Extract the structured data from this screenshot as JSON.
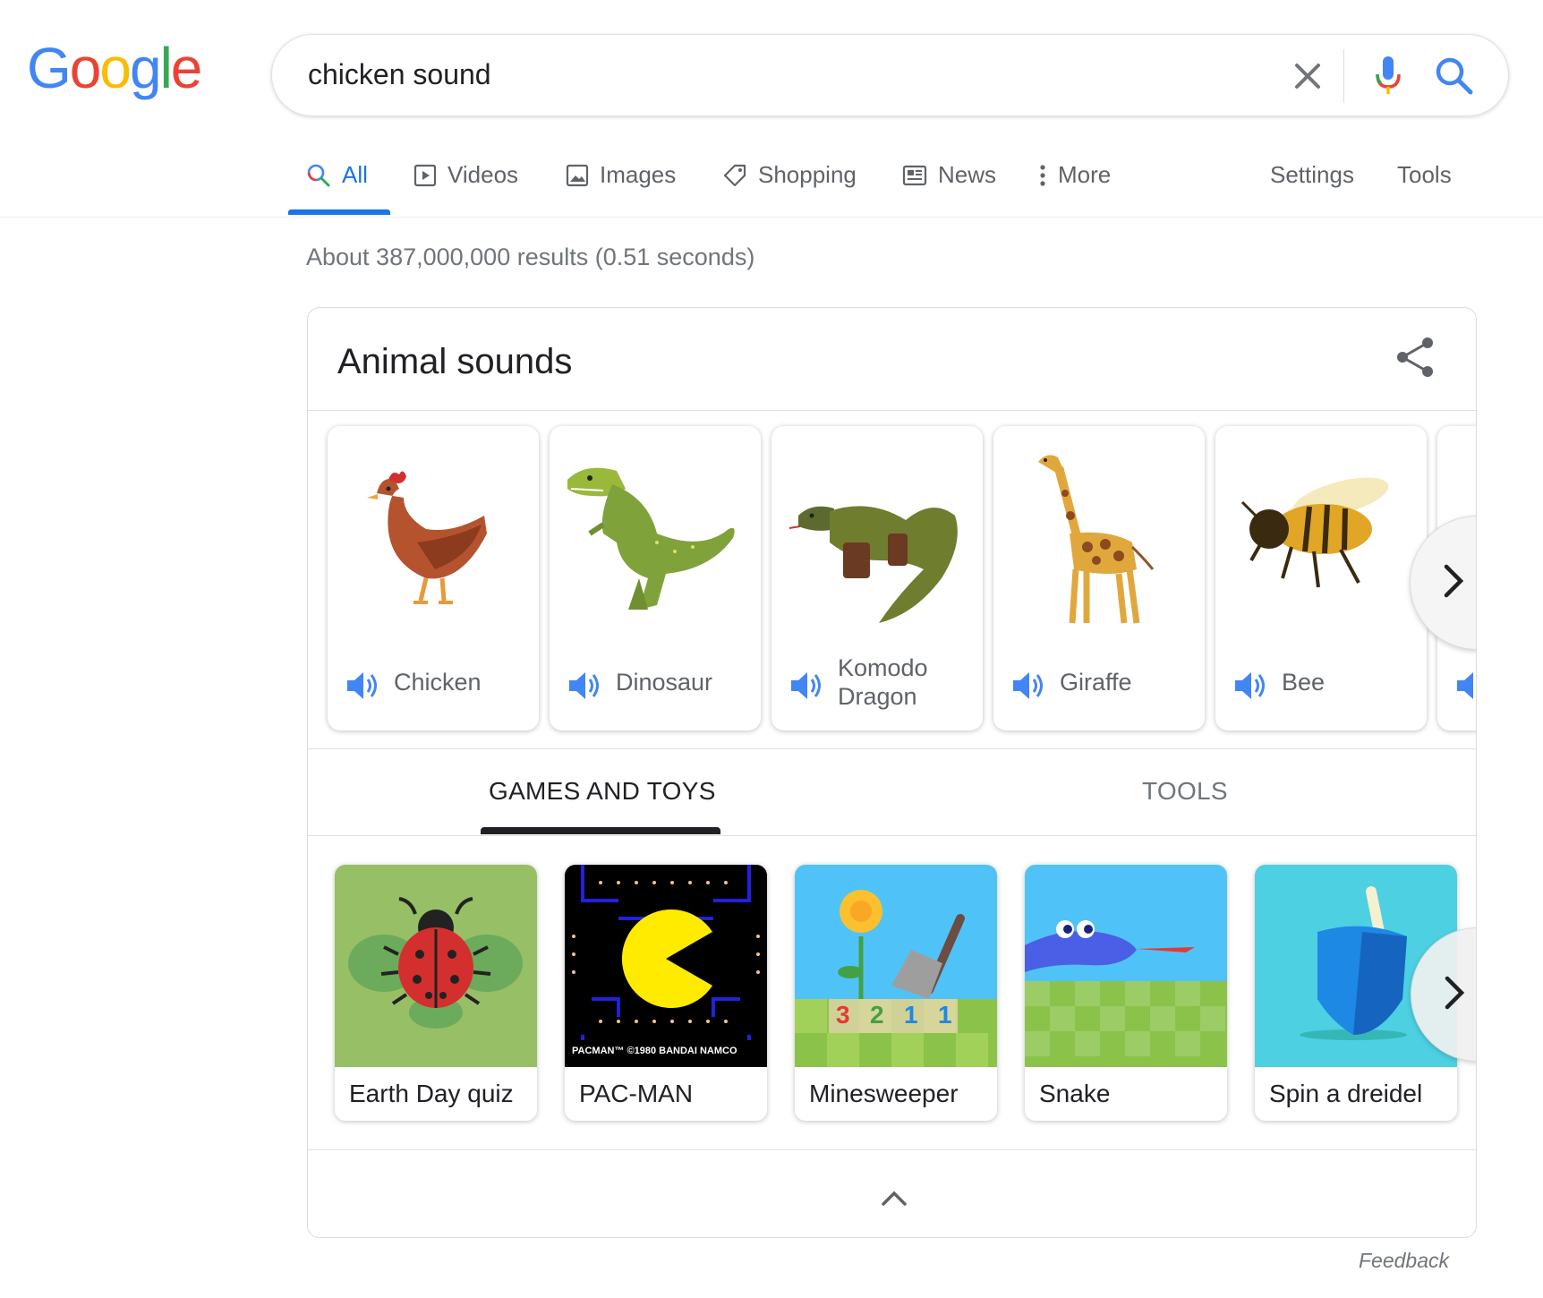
{
  "logo": {
    "letters": [
      "G",
      "o",
      "o",
      "g",
      "l",
      "e"
    ]
  },
  "search": {
    "query": "chicken sound"
  },
  "tabs": [
    {
      "label": "All",
      "icon": "search-icon",
      "active": true
    },
    {
      "label": "Videos",
      "icon": "play-icon"
    },
    {
      "label": "Images",
      "icon": "image-icon"
    },
    {
      "label": "Shopping",
      "icon": "tag-icon"
    },
    {
      "label": "News",
      "icon": "newspaper-icon"
    },
    {
      "label": "More",
      "icon": "more-vert-icon"
    }
  ],
  "tools": {
    "settings": "Settings",
    "tools": "Tools"
  },
  "results_stats": "About 387,000,000 results (0.51 seconds)",
  "card": {
    "title": "Animal sounds",
    "animals": [
      {
        "name": "Chicken"
      },
      {
        "name": "Dinosaur"
      },
      {
        "name": "Komodo\nDragon",
        "line1": "Komodo",
        "line2": "Dragon"
      },
      {
        "name": "Giraffe"
      },
      {
        "name": "Bee"
      }
    ],
    "subtabs": {
      "games": "GAMES AND TOYS",
      "tools": "TOOLS"
    },
    "games": [
      {
        "name": "Earth Day quiz"
      },
      {
        "name": "PAC-MAN",
        "credit": "PACMAN™ ©1980 BANDAI NAMCO"
      },
      {
        "name": "Minesweeper",
        "digits": [
          "3",
          "2",
          "1",
          "1"
        ]
      },
      {
        "name": "Snake"
      },
      {
        "name": "Spin a dreidel"
      }
    ]
  },
  "feedback": "Feedback",
  "colors": {
    "blue": "#4285F4",
    "red": "#EA4335",
    "yellow": "#FBBC05",
    "green": "#34A853",
    "active_tab": "#1a73e8"
  }
}
